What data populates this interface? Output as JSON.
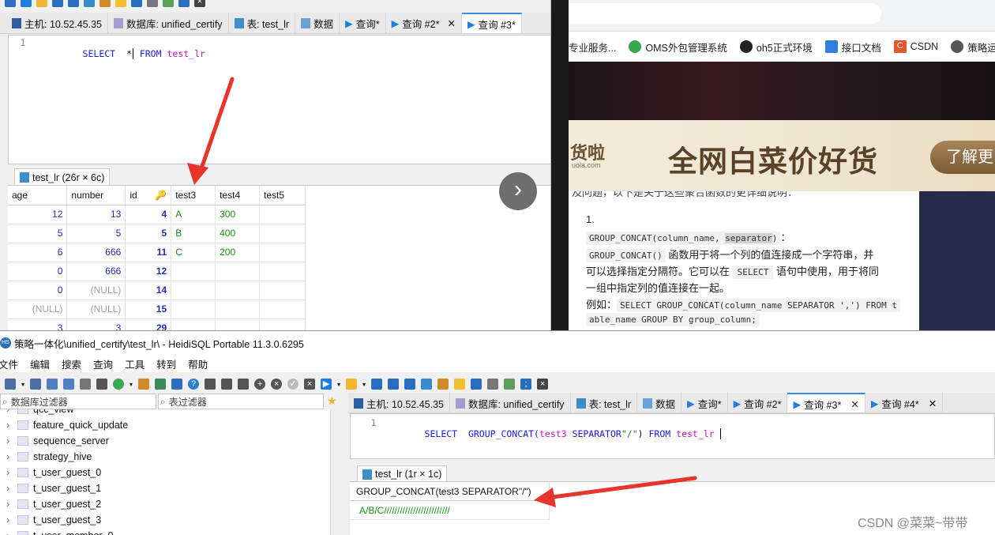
{
  "top": {
    "tabs": [
      {
        "label": "主机: 10.52.45.35"
      },
      {
        "label": "数据库: unified_certify"
      },
      {
        "label": "表: test_lr"
      },
      {
        "label": "数据"
      },
      {
        "label": "查询*"
      },
      {
        "label": "查询 #2*"
      },
      {
        "label": "查询 #3*"
      }
    ],
    "editor": {
      "line": "1",
      "kw": "SELECT",
      "star": "*",
      "from": "FROM",
      "table": "test_lr"
    },
    "result_tab": "test_lr (26r × 6c)",
    "columns": [
      "age",
      "number",
      "id",
      "test3",
      "test4",
      "test5"
    ],
    "rows": [
      [
        "12",
        "13",
        "4",
        "A",
        "300",
        ""
      ],
      [
        "5",
        "5",
        "5",
        "B",
        "400",
        ""
      ],
      [
        "6",
        "666",
        "11",
        "C",
        "200",
        ""
      ],
      [
        "0",
        "666",
        "12",
        "",
        "",
        ""
      ],
      [
        "0",
        "(NULL)",
        "14",
        "",
        "",
        ""
      ],
      [
        "(NULL)",
        "(NULL)",
        "15",
        "",
        "",
        ""
      ],
      [
        "3",
        "3",
        "29",
        "",
        "",
        ""
      ]
    ]
  },
  "browser": {
    "bookmarks": [
      "专业服务...",
      "OMS外包管理系统",
      "oh5正式环境",
      "接口文档",
      "CSDN",
      "策略运"
    ],
    "banner_brand": "货啦",
    "banner_sub": "uola.com",
    "banner_text": "全网白菜价好货",
    "banner_btn": "了解更",
    "article": {
      "top_line": "及问题，以下是关于这些聚合函数的更详细说明：",
      "list_num": "1.",
      "code1": "GROUP_CONCAT(column_name, ",
      "code1_hl": "separator",
      "code1_end": ")",
      "colon": "：",
      "code2": "GROUP_CONCAT()",
      "desc1": " 函数用于将一个列的值连接成一个字符串，并",
      "desc2a": "可以选择指定分隔符。它可以在 ",
      "code3": "SELECT",
      "desc2b": " 语句中使用，用于将同",
      "desc3": "一组中指定列的值连接在一起。",
      "example_label": "例如：",
      "code4": "SELECT GROUP_CONCAT(column_name SEPARATOR ',') FROM t",
      "code5": "able_name GROUP BY group_column;"
    },
    "next_arrow": "›"
  },
  "bottom": {
    "title": "策略一体化\\unified_certify\\test_lr\\ - HeidiSQL Portable 11.3.0.6295",
    "menu": [
      "文件",
      "编辑",
      "搜索",
      "查询",
      "工具",
      "转到",
      "帮助"
    ],
    "db_filter": "数据库过滤器",
    "table_filter": "表过滤器",
    "tree": [
      "qcc_view",
      "feature_quick_update",
      "sequence_server",
      "strategy_hive",
      "t_user_guest_0",
      "t_user_guest_1",
      "t_user_guest_2",
      "t_user_guest_3",
      "t_user_member_0"
    ],
    "tabs": [
      {
        "label": "主机: 10.52.45.35"
      },
      {
        "label": "数据库: unified_certify"
      },
      {
        "label": "表: test_lr"
      },
      {
        "label": "数据"
      },
      {
        "label": "查询*"
      },
      {
        "label": "查询 #2*"
      },
      {
        "label": "查询 #3*"
      },
      {
        "label": "查询 #4*"
      }
    ],
    "editor": {
      "line": "1",
      "kw": "SELECT",
      "fn": "GROUP_CONCAT(",
      "arg": "test3",
      "sep": " SEPARATOR",
      "str": "\"/\"",
      "close": ")",
      "from": "FROM",
      "table": "test_lr"
    },
    "result_tab": "test_lr (1r × 1c)",
    "col_header": "GROUP_CONCAT(test3 SEPARATOR\"/\")",
    "cell": "A/B/C/////////////////////////"
  },
  "watermark": "CSDN @菜菜~带带",
  "colors": {
    "arrow": "#e8352b",
    "kw": "#1a1ae0",
    "table": "#c316c3",
    "str": "#129112"
  }
}
